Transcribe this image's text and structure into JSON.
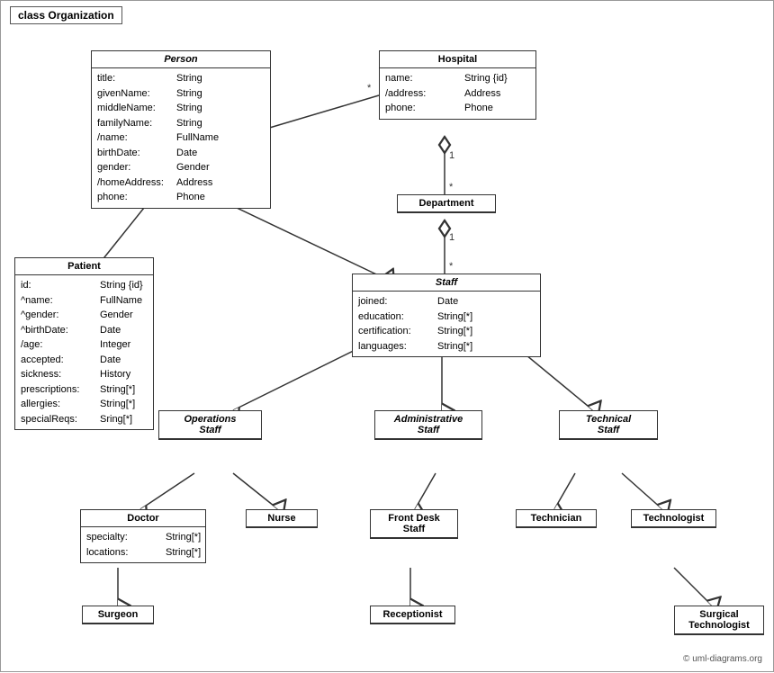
{
  "diagram": {
    "title": "class Organization",
    "classes": {
      "person": {
        "name": "Person",
        "italic": true,
        "attrs": [
          {
            "name": "title:",
            "type": "String"
          },
          {
            "name": "givenName:",
            "type": "String"
          },
          {
            "name": "middleName:",
            "type": "String"
          },
          {
            "name": "familyName:",
            "type": "String"
          },
          {
            "name": "/name:",
            "type": "FullName"
          },
          {
            "name": "birthDate:",
            "type": "Date"
          },
          {
            "name": "gender:",
            "type": "Gender"
          },
          {
            "name": "/homeAddress:",
            "type": "Address"
          },
          {
            "name": "phone:",
            "type": "Phone"
          }
        ]
      },
      "hospital": {
        "name": "Hospital",
        "italic": false,
        "attrs": [
          {
            "name": "name:",
            "type": "String {id}"
          },
          {
            "name": "/address:",
            "type": "Address"
          },
          {
            "name": "phone:",
            "type": "Phone"
          }
        ]
      },
      "department": {
        "name": "Department",
        "italic": false,
        "attrs": []
      },
      "staff": {
        "name": "Staff",
        "italic": true,
        "attrs": [
          {
            "name": "joined:",
            "type": "Date"
          },
          {
            "name": "education:",
            "type": "String[*]"
          },
          {
            "name": "certification:",
            "type": "String[*]"
          },
          {
            "name": "languages:",
            "type": "String[*]"
          }
        ]
      },
      "patient": {
        "name": "Patient",
        "italic": false,
        "attrs": [
          {
            "name": "id:",
            "type": "String {id}"
          },
          {
            "name": "^name:",
            "type": "FullName"
          },
          {
            "name": "^gender:",
            "type": "Gender"
          },
          {
            "name": "^birthDate:",
            "type": "Date"
          },
          {
            "name": "/age:",
            "type": "Integer"
          },
          {
            "name": "accepted:",
            "type": "Date"
          },
          {
            "name": "sickness:",
            "type": "History"
          },
          {
            "name": "prescriptions:",
            "type": "String[*]"
          },
          {
            "name": "allergies:",
            "type": "String[*]"
          },
          {
            "name": "specialReqs:",
            "type": "Sring[*]"
          }
        ]
      },
      "operations_staff": {
        "name": "Operations Staff",
        "italic": true
      },
      "administrative_staff": {
        "name": "Administrative Staff",
        "italic": true
      },
      "technical_staff": {
        "name": "Technical Staff",
        "italic": true
      },
      "doctor": {
        "name": "Doctor",
        "italic": false,
        "attrs": [
          {
            "name": "specialty:",
            "type": "String[*]"
          },
          {
            "name": "locations:",
            "type": "String[*]"
          }
        ]
      },
      "nurse": {
        "name": "Nurse",
        "italic": false,
        "attrs": []
      },
      "front_desk_staff": {
        "name": "Front Desk Staff",
        "italic": false,
        "attrs": []
      },
      "technician": {
        "name": "Technician",
        "italic": false,
        "attrs": []
      },
      "technologist": {
        "name": "Technologist",
        "italic": false,
        "attrs": []
      },
      "surgeon": {
        "name": "Surgeon",
        "italic": false,
        "attrs": []
      },
      "receptionist": {
        "name": "Receptionist",
        "italic": false,
        "attrs": []
      },
      "surgical_technologist": {
        "name": "Surgical Technologist",
        "italic": false,
        "attrs": []
      }
    },
    "copyright": "© uml-diagrams.org"
  }
}
